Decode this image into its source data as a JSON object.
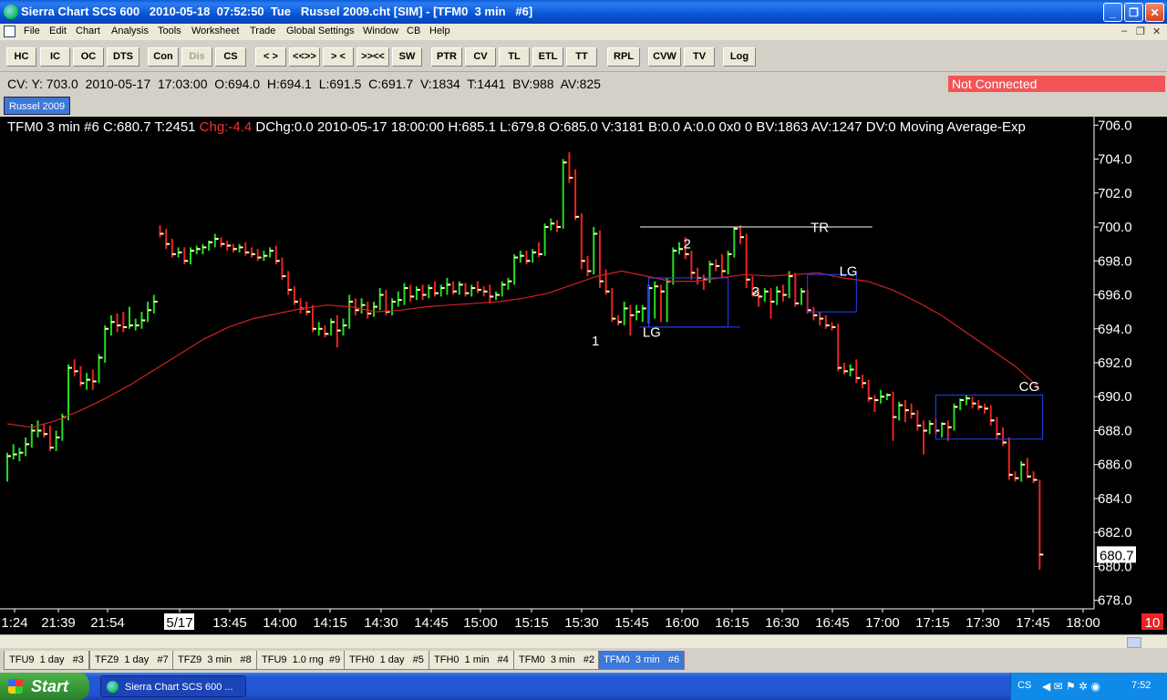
{
  "window": {
    "title": "Sierra Chart SCS 600   2010-05-18  07:52:50  Tue   Russel 2009.cht [SIM] - [TFM0  3 min   #6]",
    "buttons": {
      "minimize": "_",
      "restore": "❐",
      "close": "✕"
    }
  },
  "menu": {
    "items": [
      "File",
      "Edit",
      "Chart",
      "Analysis",
      "Tools",
      "Worksheet",
      "Trade",
      "Global Settings",
      "Window",
      "CB",
      "Help"
    ],
    "mdi_controls": [
      "–",
      "❐",
      "✕"
    ]
  },
  "toolbar": {
    "buttons": [
      "HC",
      "IC",
      "OC",
      "DTS",
      "Con",
      "Dis",
      "CS",
      "< >",
      "<<>>",
      "> <",
      ">><<",
      "SW",
      "PTR",
      "CV",
      "TL",
      "ETL",
      "TT",
      "RPL",
      "CVW",
      "TV",
      "Log"
    ],
    "disabled": [
      "Dis"
    ]
  },
  "infoline": {
    "text": "CV: Y: 703.0  2010-05-17  17:03:00  O:694.0  H:694.1  L:691.5  C:691.7  V:1834  T:1441  BV:988  AV:825",
    "status": "Not Connected"
  },
  "chartbook": {
    "tab": "Russel 2009"
  },
  "chart_header": {
    "part1": "TFM0  3 min   #6 C:680.7 T:2451 ",
    "chg": "Chg:-4.4",
    "part2": " DChg:0.0 2010-05-17 18:00:00 H:685.1 L:679.8 O:685.0 V:3181 B:0.0 A:0.0 0x0 0 BV:1863 AV:1247 DV:0 Moving Average-Exp"
  },
  "chart_data": {
    "type": "bar",
    "symbol": "TFM0",
    "interval": "3 min",
    "ylim": [
      677.5,
      706.5
    ],
    "y_ticks": [
      "706.0",
      "704.0",
      "702.0",
      "700.0",
      "698.0",
      "696.0",
      "694.0",
      "692.0",
      "690.0",
      "688.0",
      "686.0",
      "684.0",
      "682.0",
      "680.0",
      "678.0"
    ],
    "x_ticks": [
      "1:24",
      "21:39",
      "21:54",
      "5/17",
      "13:45",
      "14:00",
      "14:15",
      "14:30",
      "14:45",
      "15:00",
      "15:15",
      "15:30",
      "15:45",
      "16:00",
      "16:15",
      "16:30",
      "16:45",
      "17:00",
      "17:15",
      "17:30",
      "17:45",
      "18:00"
    ],
    "last_price": "680.7",
    "corner_badge": "10",
    "bars": [
      [
        685.4,
        686.7,
        685.0,
        686.5
      ],
      [
        686.5,
        687.2,
        686.3,
        686.6
      ],
      [
        686.6,
        687.0,
        686.2,
        686.7
      ],
      [
        686.7,
        687.6,
        686.5,
        687.2
      ],
      [
        687.2,
        688.4,
        687.0,
        688.0
      ],
      [
        688.0,
        688.6,
        687.6,
        688.0
      ],
      [
        688.0,
        688.4,
        687.6,
        687.8
      ],
      [
        687.8,
        688.3,
        686.8,
        687.0
      ],
      [
        687.0,
        688.0,
        686.8,
        687.6
      ],
      [
        687.6,
        689.0,
        687.4,
        688.8
      ],
      [
        688.8,
        691.9,
        688.6,
        691.7
      ],
      [
        691.7,
        692.2,
        691.2,
        691.5
      ],
      [
        691.5,
        691.8,
        690.6,
        690.8
      ],
      [
        690.8,
        691.4,
        690.4,
        691.0
      ],
      [
        691.0,
        691.6,
        690.4,
        690.9
      ],
      [
        690.9,
        692.5,
        690.8,
        692.3
      ],
      [
        692.3,
        694.2,
        692.0,
        694.0
      ],
      [
        694.0,
        694.8,
        693.6,
        694.4
      ],
      [
        694.4,
        694.9,
        693.8,
        694.2
      ],
      [
        694.2,
        695.0,
        693.8,
        694.1
      ],
      [
        694.1,
        695.3,
        694.0,
        694.2
      ],
      [
        694.2,
        694.6,
        693.9,
        694.2
      ],
      [
        694.2,
        695.0,
        694.0,
        694.5
      ],
      [
        694.5,
        695.6,
        694.4,
        695.1
      ],
      [
        695.1,
        696.0,
        694.9,
        695.6
      ],
      [
        699.9,
        700.1,
        699.4,
        699.6
      ],
      [
        699.6,
        699.9,
        698.7,
        699.0
      ],
      [
        699.0,
        699.3,
        698.2,
        698.4
      ],
      [
        698.4,
        698.8,
        698.2,
        698.5
      ],
      [
        698.5,
        698.8,
        697.8,
        698.0
      ],
      [
        698.0,
        698.8,
        697.8,
        698.6
      ],
      [
        698.6,
        698.9,
        698.4,
        698.7
      ],
      [
        698.7,
        699.0,
        698.4,
        698.8
      ],
      [
        698.8,
        699.2,
        698.6,
        699.1
      ],
      [
        699.1,
        699.6,
        698.8,
        699.3
      ],
      [
        699.3,
        699.4,
        698.8,
        699.0
      ],
      [
        699.0,
        699.2,
        698.6,
        698.9
      ],
      [
        698.9,
        699.0,
        698.5,
        698.7
      ],
      [
        698.7,
        699.0,
        698.5,
        698.8
      ],
      [
        698.8,
        699.1,
        698.3,
        698.5
      ],
      [
        698.5,
        698.8,
        698.2,
        698.4
      ],
      [
        698.4,
        698.7,
        698.0,
        698.2
      ],
      [
        698.2,
        698.6,
        698.0,
        698.3
      ],
      [
        698.3,
        698.8,
        698.2,
        698.6
      ],
      [
        698.6,
        698.9,
        697.8,
        698.0
      ],
      [
        698.0,
        698.2,
        696.9,
        697.1
      ],
      [
        697.1,
        697.4,
        696.0,
        696.3
      ],
      [
        696.3,
        696.5,
        695.4,
        695.6
      ],
      [
        695.6,
        695.8,
        694.9,
        695.2
      ],
      [
        695.2,
        695.6,
        694.8,
        695.0
      ],
      [
        695.0,
        695.4,
        693.8,
        694.0
      ],
      [
        694.0,
        694.4,
        693.6,
        694.0
      ],
      [
        694.0,
        694.2,
        693.5,
        693.7
      ],
      [
        693.7,
        694.6,
        693.6,
        694.4
      ],
      [
        694.4,
        694.8,
        692.9,
        693.9
      ],
      [
        693.9,
        694.6,
        693.6,
        694.2
      ],
      [
        694.2,
        696.0,
        694.0,
        695.6
      ],
      [
        695.6,
        695.8,
        694.8,
        695.1
      ],
      [
        695.1,
        695.8,
        694.9,
        695.4
      ],
      [
        695.4,
        695.6,
        694.6,
        694.9
      ],
      [
        694.9,
        695.6,
        694.7,
        695.3
      ],
      [
        695.3,
        696.4,
        695.1,
        696.0
      ],
      [
        696.0,
        696.3,
        694.8,
        695.0
      ],
      [
        695.0,
        695.8,
        694.8,
        695.6
      ],
      [
        695.6,
        696.2,
        695.3,
        695.7
      ],
      [
        695.7,
        696.7,
        695.4,
        696.4
      ],
      [
        696.4,
        696.6,
        695.6,
        695.9
      ],
      [
        695.9,
        696.5,
        695.7,
        696.3
      ],
      [
        696.3,
        696.6,
        695.7,
        696.0
      ],
      [
        696.0,
        696.6,
        695.8,
        696.4
      ],
      [
        696.4,
        696.8,
        695.9,
        696.1
      ],
      [
        696.1,
        696.6,
        695.9,
        696.4
      ],
      [
        696.4,
        697.0,
        696.0,
        696.6
      ],
      [
        696.6,
        696.8,
        696.0,
        696.2
      ],
      [
        696.2,
        696.8,
        696.0,
        696.6
      ],
      [
        696.6,
        696.7,
        695.9,
        696.1
      ],
      [
        696.1,
        696.6,
        695.9,
        696.4
      ],
      [
        696.4,
        696.8,
        696.1,
        696.3
      ],
      [
        696.3,
        696.5,
        695.9,
        696.2
      ],
      [
        696.2,
        696.6,
        695.5,
        695.9
      ],
      [
        695.9,
        696.2,
        695.7,
        696.0
      ],
      [
        696.0,
        696.8,
        695.9,
        696.6
      ],
      [
        696.6,
        697.0,
        696.3,
        696.8
      ],
      [
        696.8,
        698.4,
        696.6,
        698.2
      ],
      [
        698.2,
        698.6,
        697.9,
        698.3
      ],
      [
        698.3,
        698.6,
        697.8,
        698.0
      ],
      [
        698.0,
        698.7,
        697.9,
        698.5
      ],
      [
        698.5,
        699.1,
        698.2,
        698.4
      ],
      [
        698.4,
        700.2,
        698.3,
        700.0
      ],
      [
        700.0,
        700.5,
        699.8,
        700.2
      ],
      [
        700.2,
        700.4,
        699.7,
        700.0
      ],
      [
        700.0,
        704.0,
        699.9,
        703.8
      ],
      [
        703.8,
        704.4,
        702.6,
        702.9
      ],
      [
        702.9,
        703.4,
        700.4,
        700.6
      ],
      [
        700.6,
        700.8,
        697.5,
        698.0
      ],
      [
        698.0,
        698.3,
        697.1,
        697.4
      ],
      [
        697.4,
        700.0,
        697.2,
        699.6
      ],
      [
        699.6,
        699.8,
        696.4,
        696.8
      ],
      [
        696.8,
        697.5,
        696.0,
        696.2
      ],
      [
        696.2,
        696.4,
        694.4,
        694.6
      ],
      [
        694.6,
        694.8,
        694.2,
        694.4
      ],
      [
        694.4,
        695.6,
        694.2,
        695.2
      ],
      [
        695.2,
        695.4,
        693.6,
        694.8
      ],
      [
        694.8,
        695.4,
        694.5,
        695.0
      ],
      [
        695.0,
        695.4,
        694.4,
        695.2
      ],
      [
        695.2,
        696.6,
        694.3,
        696.4
      ],
      [
        696.4,
        696.8,
        694.6,
        696.5
      ],
      [
        696.5,
        696.6,
        694.4,
        696.2
      ],
      [
        696.2,
        697.0,
        694.4,
        696.8
      ],
      [
        696.8,
        698.8,
        696.6,
        698.6
      ],
      [
        698.6,
        699.1,
        698.4,
        698.7
      ],
      [
        698.7,
        699.4,
        698.1,
        698.4
      ],
      [
        698.4,
        698.6,
        696.9,
        697.3
      ],
      [
        697.3,
        697.6,
        696.6,
        697.0
      ],
      [
        697.0,
        697.2,
        696.3,
        696.9
      ],
      [
        696.9,
        698.0,
        696.7,
        697.8
      ],
      [
        697.8,
        698.1,
        697.4,
        697.7
      ],
      [
        697.7,
        698.4,
        697.0,
        697.4
      ],
      [
        697.4,
        698.6,
        697.2,
        698.4
      ],
      [
        698.4,
        700.0,
        698.2,
        699.9
      ],
      [
        699.9,
        700.1,
        699.0,
        699.4
      ],
      [
        699.4,
        699.6,
        696.4,
        696.9
      ],
      [
        696.9,
        697.1,
        695.9,
        696.1
      ],
      [
        696.1,
        696.3,
        695.3,
        695.9
      ],
      [
        695.9,
        696.4,
        695.6,
        696.2
      ],
      [
        696.2,
        696.4,
        694.6,
        695.6
      ],
      [
        695.6,
        696.5,
        695.4,
        696.2
      ],
      [
        696.2,
        696.6,
        695.6,
        696.0
      ],
      [
        696.0,
        697.4,
        695.8,
        697.1
      ],
      [
        697.1,
        697.3,
        695.3,
        695.5
      ],
      [
        695.5,
        696.4,
        695.4,
        696.2
      ],
      [
        696.2,
        696.3,
        694.9,
        695.1
      ],
      [
        695.1,
        695.3,
        694.5,
        694.8
      ],
      [
        694.8,
        695.0,
        694.2,
        694.6
      ],
      [
        694.6,
        694.8,
        694.0,
        694.2
      ],
      [
        694.2,
        694.4,
        693.9,
        694.1
      ],
      [
        694.1,
        694.3,
        691.5,
        691.7
      ],
      [
        691.7,
        692.0,
        691.3,
        691.5
      ],
      [
        691.5,
        691.9,
        691.2,
        691.6
      ],
      [
        691.6,
        692.2,
        690.8,
        691.1
      ],
      [
        691.1,
        691.3,
        690.5,
        690.8
      ],
      [
        690.8,
        691.0,
        689.7,
        689.9
      ],
      [
        689.9,
        690.1,
        689.1,
        689.8
      ],
      [
        689.8,
        690.4,
        689.6,
        690.0
      ],
      [
        690.0,
        690.2,
        689.8,
        690.1
      ],
      [
        690.1,
        690.3,
        687.4,
        688.8
      ],
      [
        688.8,
        689.7,
        688.6,
        689.5
      ],
      [
        689.5,
        689.8,
        688.5,
        689.2
      ],
      [
        689.2,
        689.6,
        688.7,
        689.0
      ],
      [
        689.0,
        689.2,
        688.0,
        688.3
      ],
      [
        688.3,
        688.6,
        686.6,
        688.0
      ],
      [
        688.0,
        688.6,
        687.8,
        688.4
      ],
      [
        688.4,
        688.7,
        687.8,
        688.0
      ],
      [
        688.0,
        688.5,
        687.6,
        688.4
      ],
      [
        688.4,
        688.6,
        687.4,
        688.2
      ],
      [
        688.2,
        689.6,
        688.0,
        689.4
      ],
      [
        689.4,
        689.9,
        689.2,
        689.8
      ],
      [
        689.8,
        690.1,
        689.5,
        689.9
      ],
      [
        689.9,
        690.0,
        689.3,
        689.6
      ],
      [
        689.6,
        689.8,
        689.2,
        689.4
      ],
      [
        689.4,
        689.6,
        689.0,
        689.3
      ],
      [
        689.3,
        689.5,
        688.3,
        688.6
      ],
      [
        688.6,
        688.8,
        687.5,
        687.8
      ],
      [
        687.8,
        688.2,
        687.1,
        687.3
      ],
      [
        687.3,
        687.6,
        685.1,
        685.4
      ],
      [
        685.4,
        685.6,
        685.0,
        685.2
      ],
      [
        685.2,
        686.2,
        685.0,
        686.0
      ],
      [
        686.0,
        686.4,
        685.2,
        685.3
      ],
      [
        685.3,
        685.6,
        684.9,
        685.1
      ],
      [
        685.0,
        685.1,
        679.8,
        680.7
      ]
    ],
    "moving_average": [
      688.4,
      688.2,
      688.6,
      689.2,
      689.9,
      690.7,
      691.6,
      692.5,
      693.4,
      694.1,
      694.6,
      694.9,
      695.2,
      695.4,
      695.3,
      695.0,
      695.1,
      695.3,
      695.4,
      695.5,
      695.6,
      695.8,
      696.1,
      696.6,
      697.1,
      697.4,
      697.1,
      696.8,
      696.8,
      697.0,
      697.2,
      697.1,
      697.2,
      697.3,
      697.0,
      696.8,
      696.3,
      695.6,
      694.8,
      693.8,
      692.8,
      691.8,
      690.5
    ],
    "annotations": [
      {
        "text": "TR",
        "x": 157,
        "y": 699.98,
        "kind": "line-label"
      },
      {
        "text": "1",
        "x": 120.3,
        "y": 693.3,
        "kind": "label"
      },
      {
        "text": "2",
        "x": 135.3,
        "y": 699.0,
        "kind": "label"
      },
      {
        "text": "3",
        "x": 146.5,
        "y": 696.2,
        "kind": "label"
      },
      {
        "text": "LG",
        "x": 129.5,
        "y": 693.8,
        "kind": "label"
      },
      {
        "text": "LG",
        "x": 161.7,
        "y": 697.4,
        "kind": "label"
      },
      {
        "text": "CG",
        "x": 191.3,
        "y": 690.6,
        "kind": "label"
      }
    ],
    "grid": false,
    "legend": "none"
  },
  "sheet_tabs": [
    {
      "label": "TFU9  1 day   #3",
      "active": false
    },
    {
      "label": "TFZ9  1 day   #7",
      "active": false
    },
    {
      "label": "TFZ9  3 min   #8",
      "active": false
    },
    {
      "label": "TFU9  1.0 rng  #9",
      "active": false
    },
    {
      "label": "TFH0  1 day   #5",
      "active": false
    },
    {
      "label": "TFH0  1 min   #4",
      "active": false
    },
    {
      "label": "TFM0  3 min   #2",
      "active": false
    },
    {
      "label": "TFM0  3 min   #6",
      "active": true
    }
  ],
  "taskbar": {
    "start": "Start",
    "item": "Sierra Chart SCS 600 ...",
    "tray_lang": "CS",
    "tray_icons": "◀ ✉ ⚑ ✲ ◉",
    "clock": "7:52"
  },
  "colors": {
    "up": "#22dd22",
    "down": "#ee2222",
    "close_tick": "#ffffbb",
    "ma": "#d42020",
    "box": "#2244ff"
  }
}
